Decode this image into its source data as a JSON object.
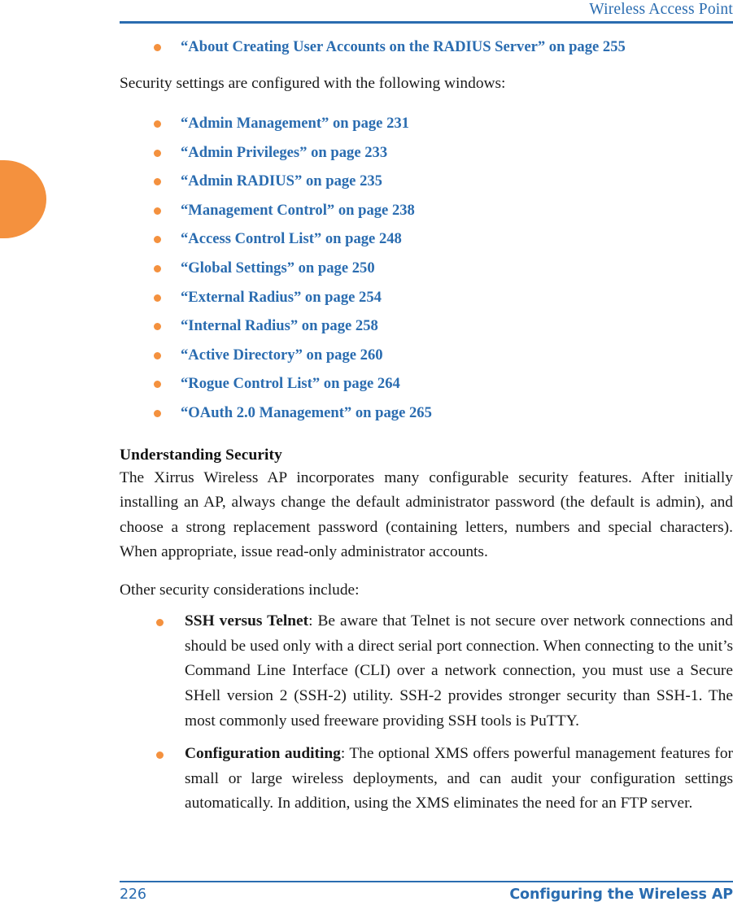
{
  "header": {
    "title": "Wireless Access Point"
  },
  "decor": {
    "thumb_tab_color": "#f4913e"
  },
  "colors": {
    "link_blue": "#2a6cb0",
    "bullet_orange": "#f4913e",
    "body_black": "#1a1a1a"
  },
  "content": {
    "top_link": "“About Creating User Accounts on the RADIUS Server” on page 255",
    "intro_paragraph": "Security settings are configured with the following windows:",
    "windows_links": [
      "“Admin Management” on page 231",
      "“Admin Privileges” on page 233",
      "“Admin RADIUS” on page 235",
      "“Management Control” on page 238",
      "“Access Control List” on page 248",
      "“Global Settings” on page 250",
      "“External Radius” on page 254",
      "“Internal Radius” on page 258",
      "“Active Directory” on page 260",
      "“Rogue Control List” on page 264",
      "“OAuth 2.0 Management” on page 265"
    ],
    "section_heading": "Understanding Security",
    "section_paragraph": "The Xirrus Wireless AP incorporates many configurable security features. After initially installing an AP, always change the default administrator password (the default is admin), and choose a strong replacement password (containing letters, numbers and special characters). When appropriate, issue read-only administrator accounts.",
    "considerations_lead": "Other security considerations include:",
    "considerations": [
      {
        "term": "SSH versus Telnet",
        "text": ": Be aware that Telnet is not secure over network connections and should be used only with a direct serial port connection. When connecting to the unit’s Command Line Interface (CLI) over a network connection, you must use a Secure SHell version 2 (SSH-2) utility. SSH-2 provides stronger security than SSH-1. The most commonly used freeware providing SSH tools is PuTTY."
      },
      {
        "term": "Configuration auditing",
        "text": ": The optional XMS offers powerful management features for small or large wireless deployments, and can audit your configuration settings automatically. In addition, using the XMS eliminates the need for an FTP server."
      }
    ]
  },
  "footer": {
    "page_number": "226",
    "section_title": "Configuring the Wireless AP"
  }
}
